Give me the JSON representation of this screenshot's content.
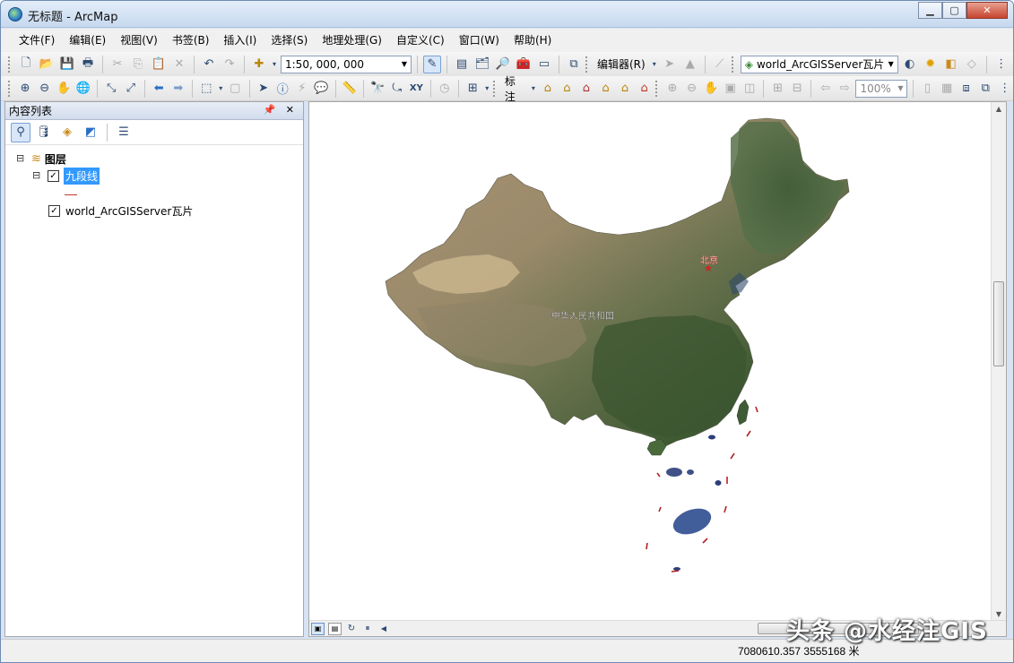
{
  "window": {
    "title": "无标题 - ArcMap",
    "minimize_symbol": "▁",
    "maximize_symbol": "▢",
    "close_symbol": "✕"
  },
  "menu": [
    "文件(F)",
    "编辑(E)",
    "视图(V)",
    "书签(B)",
    "插入(I)",
    "选择(S)",
    "地理处理(G)",
    "自定义(C)",
    "窗口(W)",
    "帮助(H)"
  ],
  "toolbar1": {
    "scale": "1:50, 000, 000",
    "editor_label": "编辑器(R)",
    "layer_combo": "world_ArcGISServer瓦片"
  },
  "toolbar2": {
    "label_tool": "标注",
    "zoom_percent": "100%"
  },
  "toc": {
    "title": "内容列表",
    "pin_symbols": "📌 ✕",
    "root_label": "图层",
    "layers": [
      {
        "name": "九段线",
        "checked": true,
        "selected": true,
        "expander": "⊟"
      },
      {
        "name": "world_ArcGISServer瓦片",
        "checked": true,
        "selected": false
      }
    ],
    "root_expander": "⊟",
    "legend_line_color": "#c0392b"
  },
  "map": {
    "capital_label": "北京",
    "country_label": "中华人民共和国",
    "nine_dash_color": "#b22222",
    "land_color": "#5b6f45"
  },
  "status": {
    "coordinates": "7080610.357  3555168 米"
  },
  "watermark": "头条 @水经注GIS"
}
